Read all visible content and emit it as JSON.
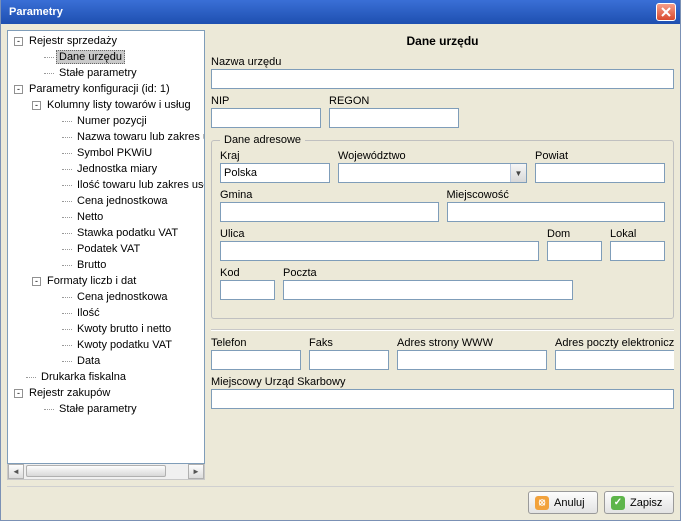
{
  "window": {
    "title": "Parametry"
  },
  "tree": [
    {
      "label": "Rejestr sprzedaży",
      "level": 0,
      "toggle": "-"
    },
    {
      "label": "Dane urzędu",
      "level": 1,
      "selected": true
    },
    {
      "label": "Stałe parametry",
      "level": 1
    },
    {
      "label": "Parametry konfiguracji (id: 1)",
      "level": 0,
      "toggle": "-"
    },
    {
      "label": "Kolumny listy towarów i usług",
      "level": 1,
      "toggle": "-"
    },
    {
      "label": "Numer pozycji",
      "level": 2
    },
    {
      "label": "Nazwa towaru lub zakres usł",
      "level": 2
    },
    {
      "label": "Symbol PKWiU",
      "level": 2
    },
    {
      "label": "Jednostka miary",
      "level": 2
    },
    {
      "label": "Ilość towaru lub zakres usług",
      "level": 2
    },
    {
      "label": "Cena jednostkowa",
      "level": 2
    },
    {
      "label": "Netto",
      "level": 2
    },
    {
      "label": "Stawka podatku VAT",
      "level": 2
    },
    {
      "label": "Podatek VAT",
      "level": 2
    },
    {
      "label": "Brutto",
      "level": 2
    },
    {
      "label": "Formaty liczb i dat",
      "level": 1,
      "toggle": "-"
    },
    {
      "label": "Cena jednostkowa",
      "level": 2
    },
    {
      "label": "Ilość",
      "level": 2
    },
    {
      "label": "Kwoty brutto i netto",
      "level": 2
    },
    {
      "label": "Kwoty podatku VAT",
      "level": 2
    },
    {
      "label": "Data",
      "level": 2
    },
    {
      "label": "Drukarka fiskalna",
      "level": 0
    },
    {
      "label": "Rejestr zakupów",
      "level": 0,
      "toggle": "-"
    },
    {
      "label": "Stałe parametry",
      "level": 1
    }
  ],
  "form": {
    "heading": "Dane urzędu",
    "labels": {
      "office_name": "Nazwa urzędu",
      "nip": "NIP",
      "regon": "REGON",
      "address_group": "Dane adresowe",
      "country": "Kraj",
      "voivodeship": "Województwo",
      "district": "Powiat",
      "commune": "Gmina",
      "locality": "Miejscowość",
      "street": "Ulica",
      "house": "Dom",
      "apartment": "Lokal",
      "postal": "Kod",
      "post": "Poczta",
      "phone": "Telefon",
      "fax": "Faks",
      "www": "Adres strony WWW",
      "email": "Adres poczty elektronicznej",
      "tax_office": "Miejscowy Urząd Skarbowy"
    },
    "values": {
      "country": "Polska"
    }
  },
  "buttons": {
    "cancel": "Anuluj",
    "save": "Zapisz"
  }
}
